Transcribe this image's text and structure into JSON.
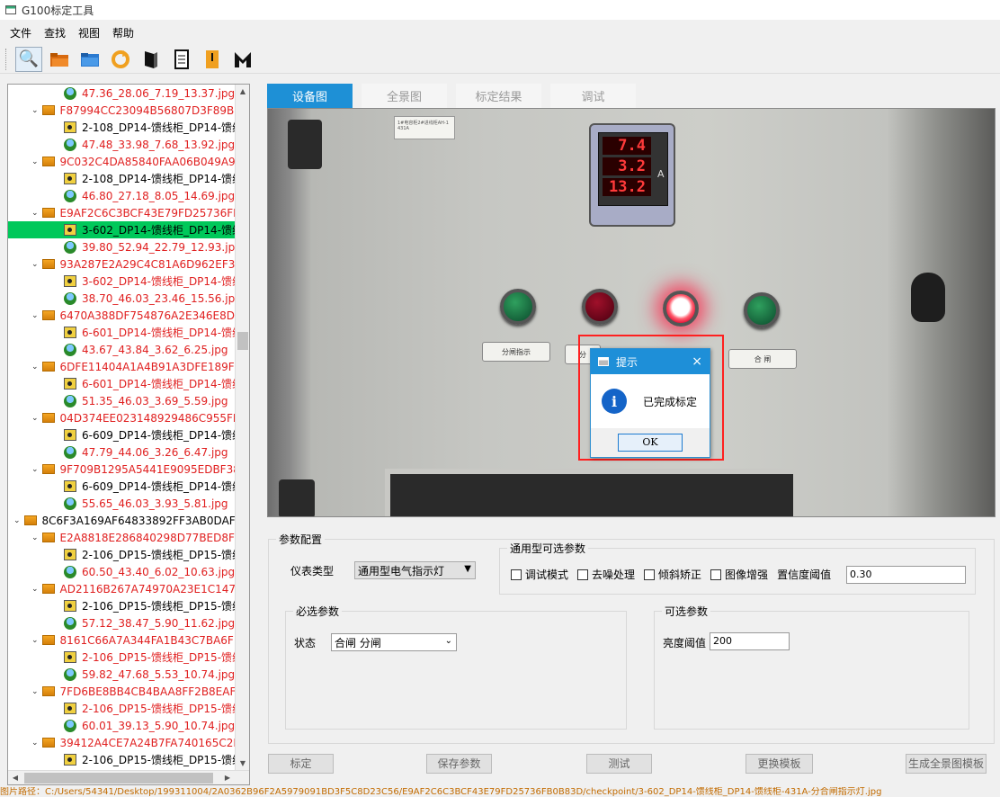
{
  "window": {
    "title": "G100标定工具"
  },
  "menu": [
    "文件",
    "查找",
    "视图",
    "帮助"
  ],
  "toolbar": [
    "search-doc-icon",
    "folder-open-icon",
    "folder-blue-icon",
    "refresh-icon",
    "book-icon",
    "document-icon",
    "bookmark-icon",
    "logo-m-icon"
  ],
  "tree": {
    "rows": [
      {
        "level": 2,
        "kind": "img",
        "text": "47.36_28.06_7.19_13.37.jpg",
        "red": true
      },
      {
        "level": 1,
        "kind": "folder",
        "text": "F87994CC23094B56807D3F89BF7",
        "red": true,
        "expanded": true
      },
      {
        "level": 2,
        "kind": "cam",
        "text": "2-108_DP14-馈线柜_DP14-馈线",
        "red": false
      },
      {
        "level": 2,
        "kind": "img",
        "text": "47.48_33.98_7.68_13.92.jpg",
        "red": true
      },
      {
        "level": 1,
        "kind": "folder",
        "text": "9C032C4DA85840FAA06B049A9C",
        "red": true,
        "expanded": true
      },
      {
        "level": 2,
        "kind": "cam",
        "text": "2-108_DP14-馈线柜_DP14-馈线",
        "red": false
      },
      {
        "level": 2,
        "kind": "img",
        "text": "46.80_27.18_8.05_14.69.jpg",
        "red": true
      },
      {
        "level": 1,
        "kind": "folder",
        "text": "E9AF2C6C3BCF43E79FD25736FB",
        "red": true,
        "expanded": true
      },
      {
        "level": 2,
        "kind": "cam",
        "text": "3-602_DP14-馈线柜_DP14-馈线",
        "red": false,
        "selected": true
      },
      {
        "level": 2,
        "kind": "img",
        "text": "39.80_52.94_22.79_12.93.jpg",
        "red": true
      },
      {
        "level": 1,
        "kind": "folder",
        "text": "93A287E2A29C4C81A6D962EF31",
        "red": true,
        "expanded": true
      },
      {
        "level": 2,
        "kind": "cam",
        "text": "3-602_DP14-馈线柜_DP14-馈线",
        "red": true
      },
      {
        "level": 2,
        "kind": "img",
        "text": "38.70_46.03_23.46_15.56.jpg",
        "red": true
      },
      {
        "level": 1,
        "kind": "folder",
        "text": "6470A388DF754876A2E346E8DF",
        "red": true,
        "expanded": true
      },
      {
        "level": 2,
        "kind": "cam",
        "text": "6-601_DP14-馈线柜_DP14-馈线",
        "red": true
      },
      {
        "level": 2,
        "kind": "img",
        "text": "43.67_43.84_3.62_6.25.jpg",
        "red": true
      },
      {
        "level": 1,
        "kind": "folder",
        "text": "6DFE11404A1A4B91A3DFE189FD",
        "red": true,
        "expanded": true
      },
      {
        "level": 2,
        "kind": "cam",
        "text": "6-601_DP14-馈线柜_DP14-馈线",
        "red": true
      },
      {
        "level": 2,
        "kind": "img",
        "text": "51.35_46.03_3.69_5.59.jpg",
        "red": true
      },
      {
        "level": 1,
        "kind": "folder",
        "text": "04D374EE023148929486C955FEE",
        "red": true,
        "expanded": true
      },
      {
        "level": 2,
        "kind": "cam",
        "text": "6-609_DP14-馈线柜_DP14-馈线",
        "red": false
      },
      {
        "level": 2,
        "kind": "img",
        "text": "47.79_44.06_3.26_6.47.jpg",
        "red": true
      },
      {
        "level": 1,
        "kind": "folder",
        "text": "9F709B1295A5441E9095EDBF380",
        "red": true,
        "expanded": true
      },
      {
        "level": 2,
        "kind": "cam",
        "text": "6-609_DP14-馈线柜_DP14-馈线",
        "red": false
      },
      {
        "level": 2,
        "kind": "img",
        "text": "55.65_46.03_3.93_5.81.jpg",
        "red": true
      },
      {
        "level": 0,
        "kind": "folder",
        "text": "8C6F3A169AF64833892FF3AB0DAF2",
        "red": false,
        "expanded": true
      },
      {
        "level": 1,
        "kind": "folder",
        "text": "E2A8818E286840298D77BED8F6",
        "red": true,
        "expanded": true
      },
      {
        "level": 2,
        "kind": "cam",
        "text": "2-106_DP15-馈线柜_DP15-馈线",
        "red": false
      },
      {
        "level": 2,
        "kind": "img",
        "text": "60.50_43.40_6.02_10.63.jpg",
        "red": true
      },
      {
        "level": 1,
        "kind": "folder",
        "text": "AD2116B267A74970A23E1C147C",
        "red": true,
        "expanded": true
      },
      {
        "level": 2,
        "kind": "cam",
        "text": "2-106_DP15-馈线柜_DP15-馈线",
        "red": false
      },
      {
        "level": 2,
        "kind": "img",
        "text": "57.12_38.47_5.90_11.62.jpg",
        "red": true
      },
      {
        "level": 1,
        "kind": "folder",
        "text": "8161C66A7A344FA1B43C7BA6FE",
        "red": true,
        "expanded": true
      },
      {
        "level": 2,
        "kind": "cam",
        "text": "2-106_DP15-馈线柜_DP15-馈线",
        "red": true
      },
      {
        "level": 2,
        "kind": "img",
        "text": "59.82_47.68_5.53_10.74.jpg",
        "red": true
      },
      {
        "level": 1,
        "kind": "folder",
        "text": "7FD6BE8BB4CB4BAA8FF2B8EAFF",
        "red": true,
        "expanded": true
      },
      {
        "level": 2,
        "kind": "cam",
        "text": "2-106_DP15-馈线柜_DP15-馈线",
        "red": true
      },
      {
        "level": 2,
        "kind": "img",
        "text": "60.01_39.13_5.90_10.74.jpg",
        "red": true
      },
      {
        "level": 1,
        "kind": "folder",
        "text": "39412A4CE7A24B7FA740165C2E",
        "red": true,
        "expanded": true
      },
      {
        "level": 2,
        "kind": "cam",
        "text": "2-106_DP15-馈线柜_DP15-馈线",
        "red": false
      }
    ]
  },
  "tabs": [
    {
      "label": "设备图",
      "active": true
    },
    {
      "label": "全景图",
      "active": false
    },
    {
      "label": "标定结果",
      "active": false
    },
    {
      "label": "调试",
      "active": false
    }
  ],
  "photo": {
    "label_top": "1#电容柜2#进线柜AH-1 431A",
    "meter_readings": [
      "7.4",
      "3.2",
      "13.2"
    ],
    "meter_unit": "A",
    "tags": [
      "分闸指示",
      "分",
      "合 闸"
    ]
  },
  "dialog": {
    "title": "提示",
    "message": "已完成标定",
    "ok": "OK",
    "close": "×",
    "info": "i"
  },
  "config": {
    "group_title": "参数配置",
    "meter_type_label": "仪表类型",
    "meter_type_value": "通用型电气指示灯",
    "general_group": "通用型可选参数",
    "checks": [
      "调试模式",
      "去噪处理",
      "倾斜矫正",
      "图像增强"
    ],
    "confidence_label": "置信度阈值",
    "confidence_value": "0.30",
    "required_group": "必选参数",
    "state_label": "状态",
    "state_value": "合闸 分闸",
    "optional_group": "可选参数",
    "brightness_label": "亮度阈值",
    "brightness_value": "200"
  },
  "buttons": [
    "标定",
    "保存参数",
    "测试",
    "更换模板",
    "生成全景图模板"
  ],
  "status": "图片路径：C:/Users/54341/Desktop/199311004/2A0362B96F2A5979091BD3F5C8D23C56/E9AF2C6C3BCF43E79FD25736FB0B83D/checkpoint/3-602_DP14-馈线柜_DP14-馈线柜-431A-分合闸指示灯.jpg",
  "colors": {
    "accent": "#1e90d6",
    "selected_row": "#00c85a",
    "error_text": "#e02020",
    "highlight_box": "#ff2020"
  }
}
